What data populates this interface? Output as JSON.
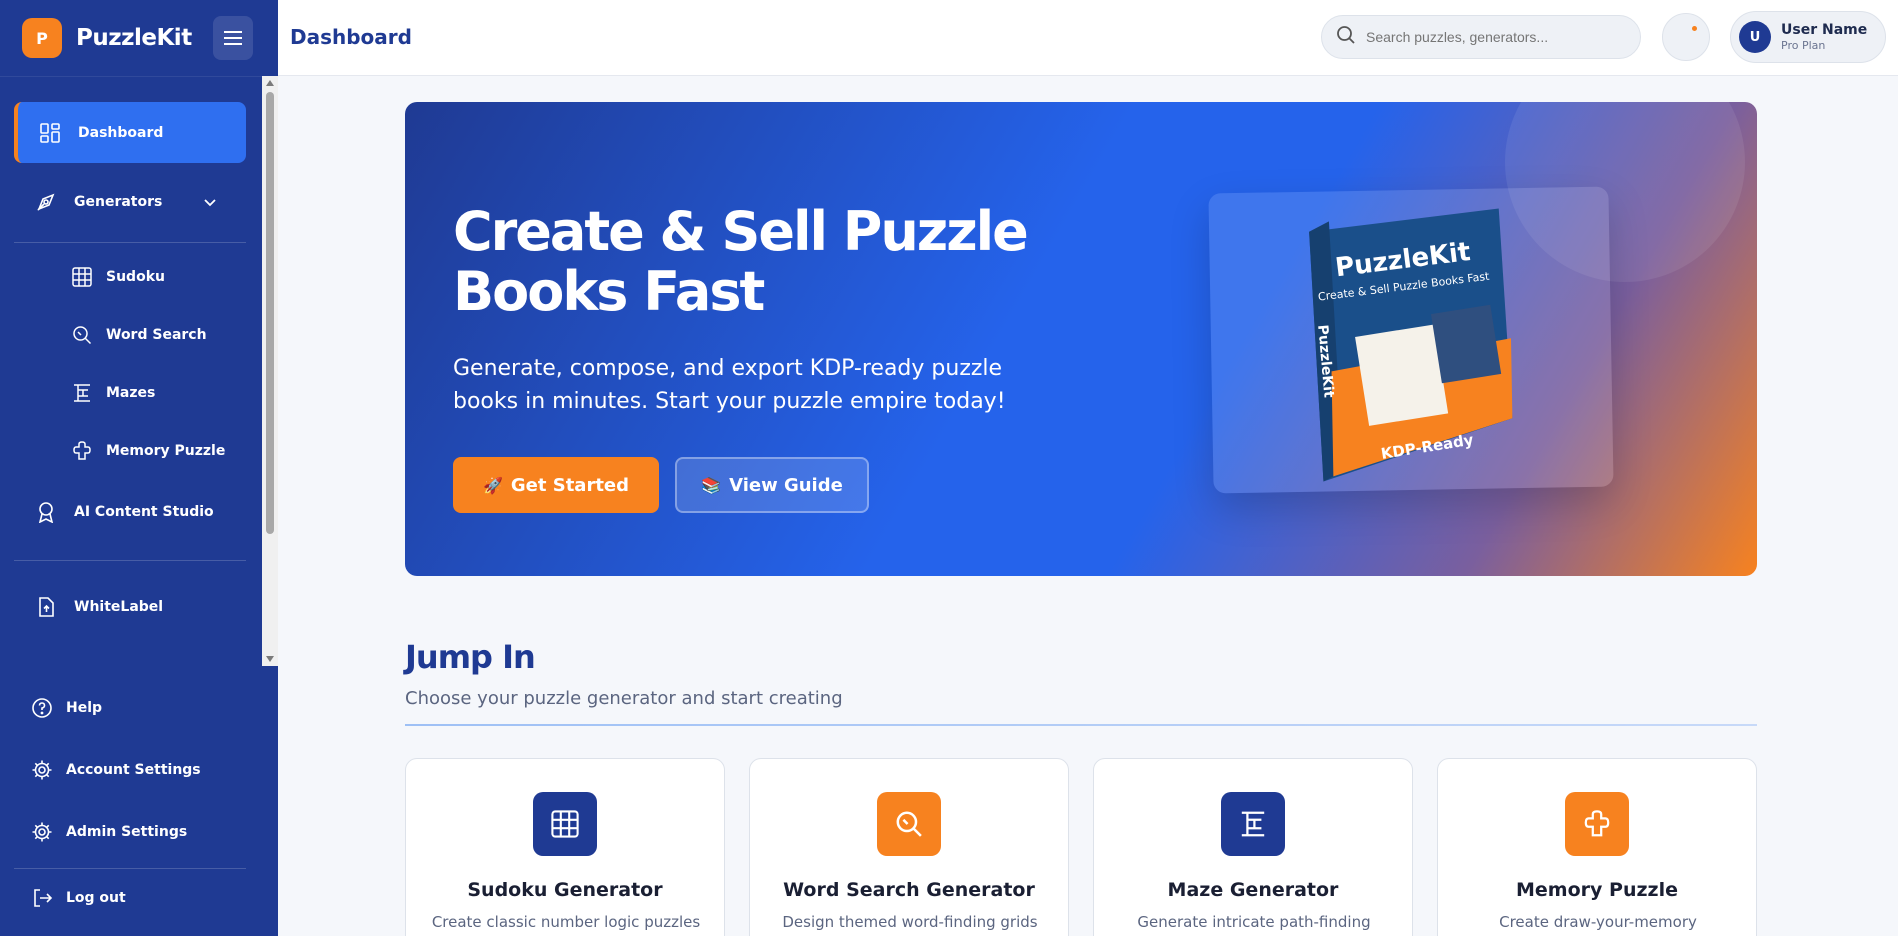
{
  "app": {
    "logo_letter": "P",
    "name": "PuzzleKit"
  },
  "header": {
    "title": "Dashboard",
    "search_placeholder": "Search puzzles, generators...",
    "user": {
      "initial": "U",
      "name": "User Name",
      "plan": "Pro Plan"
    }
  },
  "sidebar": {
    "items": [
      {
        "label": "Dashboard",
        "icon": "dashboard-grid-icon",
        "active": true
      },
      {
        "label": "Generators",
        "icon": "pen-tool-icon"
      },
      {
        "label": "Sudoku",
        "icon": "grid-icon"
      },
      {
        "label": "Word Search",
        "icon": "search-icon"
      },
      {
        "label": "Mazes",
        "icon": "maze-icon"
      },
      {
        "label": "Memory Puzzle",
        "icon": "puzzle-piece-icon"
      },
      {
        "label": "AI Content Studio",
        "icon": "award-icon"
      },
      {
        "label": "WhiteLabel",
        "icon": "file-upload-icon"
      }
    ],
    "bottom": [
      {
        "label": "Help",
        "icon": "help-icon"
      },
      {
        "label": "Account Settings",
        "icon": "gear-icon"
      },
      {
        "label": "Admin Settings",
        "icon": "gear-icon"
      },
      {
        "label": "Log out",
        "icon": "logout-icon"
      }
    ]
  },
  "hero": {
    "title": "Create & Sell Puzzle Books Fast",
    "subtitle": "Generate, compose, and export KDP-ready puzzle books in minutes. Start your puzzle empire today!",
    "primary_icon": "🚀",
    "primary_label": "Get Started",
    "secondary_icon": "📚",
    "secondary_label": "View Guide",
    "product": {
      "brand": "PuzzleKit",
      "tagline": "Create & Sell Puzzle Books Fast",
      "spine": "PuzzleKit",
      "badge": "KDP-Ready"
    }
  },
  "jump_in": {
    "title": "Jump In",
    "subtitle": "Choose your puzzle generator and start creating",
    "cards": [
      {
        "title": "Sudoku Generator",
        "desc": "Create classic number logic puzzles",
        "icon": "grid-icon",
        "color": "#1f3a93"
      },
      {
        "title": "Word Search Generator",
        "desc": "Design themed word-finding grids",
        "icon": "search-icon",
        "color": "#f7821f"
      },
      {
        "title": "Maze Generator",
        "desc": "Generate intricate path-finding",
        "icon": "maze-icon",
        "color": "#1f3a93"
      },
      {
        "title": "Memory Puzzle",
        "desc": "Create draw-your-memory",
        "icon": "puzzle-piece-icon",
        "color": "#f7821f"
      }
    ]
  },
  "colors": {
    "primary": "#1f3a93",
    "accent": "#f7821f",
    "active": "#2f6ff0"
  }
}
